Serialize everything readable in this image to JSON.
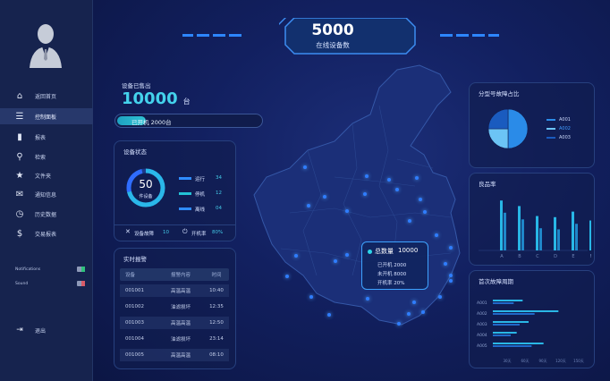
{
  "sidebar": {
    "items": [
      {
        "label": "返回首页",
        "icon": "home-icon"
      },
      {
        "label": "控制面板",
        "icon": "list-icon",
        "active": true
      },
      {
        "label": "报表",
        "icon": "bar-chart-icon"
      },
      {
        "label": "检索",
        "icon": "search-icon"
      },
      {
        "label": "文件夹",
        "icon": "star-icon"
      },
      {
        "label": "通知信息",
        "icon": "notification-icon"
      },
      {
        "label": "历史数据",
        "icon": "clock-icon"
      },
      {
        "label": "交易报表",
        "icon": "dollar-icon"
      }
    ],
    "toggles": [
      {
        "label": "Notifications",
        "state": "on"
      },
      {
        "label": "Sound",
        "state": "off"
      }
    ],
    "logout_label": "退出"
  },
  "header": {
    "online_count": "5000",
    "online_label": "在线设备数"
  },
  "sold": {
    "label": "设备已售出",
    "value": "10000",
    "unit": "台",
    "progress_label": "已开机 2000台",
    "progress_fraction": 0.2
  },
  "device_status": {
    "title": "设备状态",
    "ring_value": "50",
    "ring_label": "件设备",
    "legend": [
      {
        "label": "运行",
        "value": "34",
        "color": "#2f8cff"
      },
      {
        "label": "停机",
        "value": "12",
        "color": "#23c2d6"
      },
      {
        "label": "离线",
        "value": "04",
        "color": "#2f8cff"
      }
    ],
    "fault_label": "设备故障",
    "fault_value": "10",
    "power_label": "开机率",
    "power_value": "80%"
  },
  "alarms": {
    "title": "实时报警",
    "columns": [
      "设备",
      "报警内容",
      "时间"
    ],
    "rows": [
      [
        "001001",
        "高温高温",
        "10:40"
      ],
      [
        "001002",
        "油滤损坏",
        "12:35"
      ],
      [
        "001003",
        "高温高温",
        "12:50"
      ],
      [
        "001004",
        "油滤损坏",
        "23:14"
      ],
      [
        "001005",
        "高温高温",
        "08:10"
      ]
    ]
  },
  "map_tooltip": {
    "total_label": "总数量",
    "total_value": "10000",
    "lines": [
      "已开机 2000",
      "未开机 8000",
      "开机率 20%"
    ]
  },
  "pie": {
    "title": "分型号故障占比",
    "legend": [
      "A001",
      "A002",
      "A003"
    ],
    "colors": [
      "#2a8be8",
      "#6cc4f5",
      "#1a5bbf"
    ]
  },
  "chart_data": [
    {
      "type": "pie",
      "title": "分型号故障占比",
      "categories": [
        "A001",
        "A002",
        "A003"
      ],
      "values": [
        50,
        25,
        25
      ]
    },
    {
      "type": "bar",
      "title": "良品率",
      "categories": [
        "A",
        "B",
        "C",
        "D",
        "E",
        "F"
      ],
      "series": [
        {
          "values": [
            90,
            80,
            62,
            60,
            70,
            54
          ]
        },
        {
          "values": [
            68,
            56,
            40,
            38,
            48,
            34
          ]
        }
      ],
      "ylim": [
        0,
        100
      ]
    },
    {
      "type": "bar",
      "title": "首次故障周期",
      "categories": [
        "A001",
        "A002",
        "A003",
        "A004",
        "A005"
      ],
      "series": [
        {
          "values": [
            50,
            110,
            60,
            40,
            85
          ]
        },
        {
          "values": [
            35,
            70,
            45,
            30,
            65
          ]
        }
      ],
      "xticks": [
        "30天",
        "60天",
        "90天",
        "120天",
        "150天"
      ],
      "xlim": [
        0,
        150
      ]
    }
  ]
}
